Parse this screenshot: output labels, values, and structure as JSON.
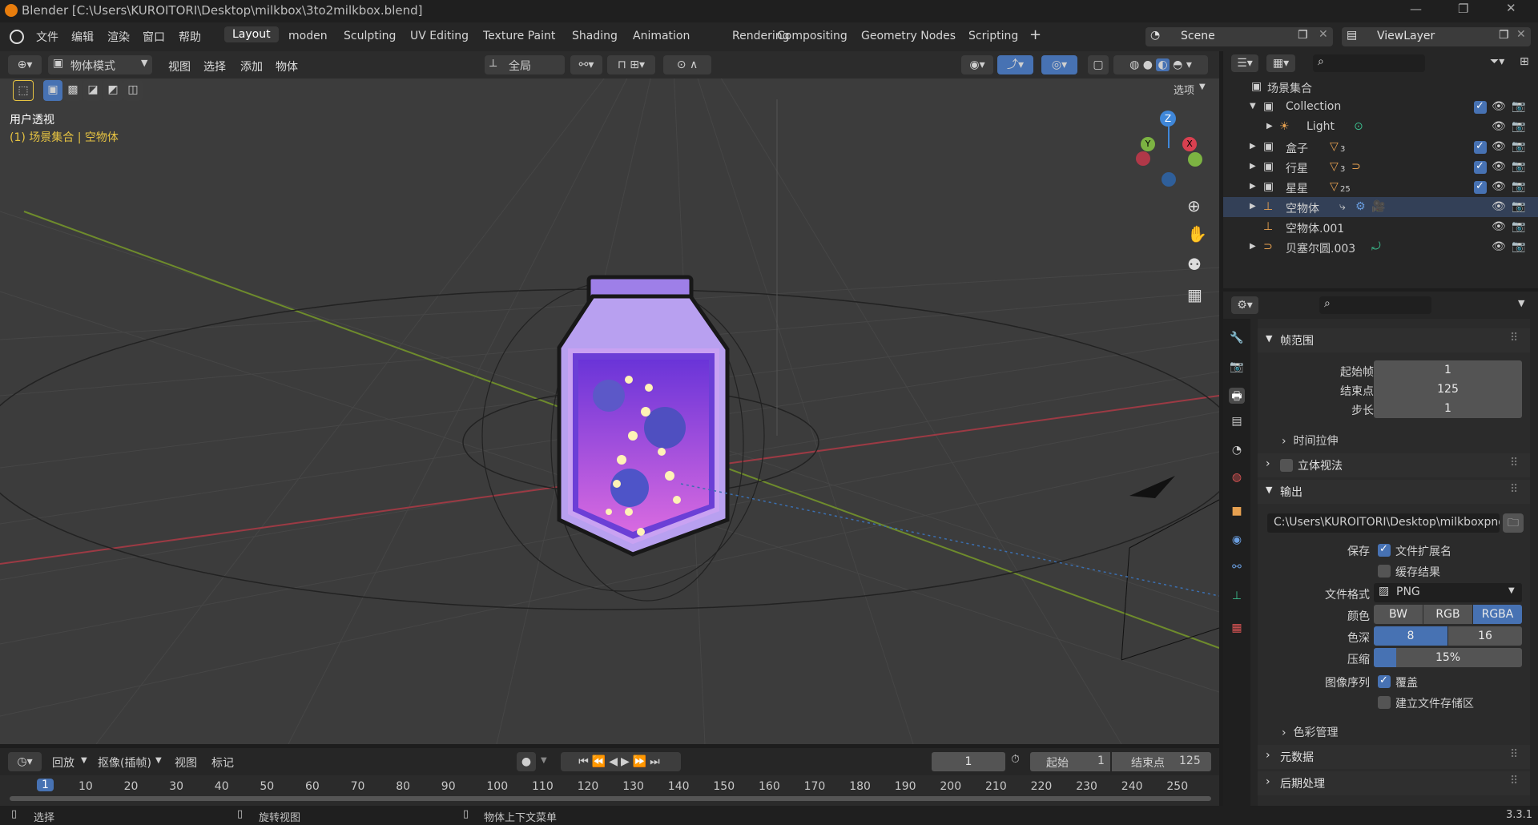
{
  "window": {
    "title": "Blender [C:\\Users\\KUROITORI\\Desktop\\milkbox\\3to2milkbox.blend]"
  },
  "menu": {
    "items": [
      "文件",
      "编辑",
      "渲染",
      "窗口",
      "帮助"
    ]
  },
  "workspaces": [
    "Layout",
    "moden",
    "Sculpting",
    "UV Editing",
    "Texture Paint",
    "Shading",
    "Animation",
    "Rendering",
    "Compositing",
    "Geometry Nodes",
    "Scripting"
  ],
  "active_workspace": "Layout",
  "scene": {
    "name": "Scene",
    "view_layer": "ViewLayer"
  },
  "viewport": {
    "mode": "物体模式",
    "menus": [
      "视图",
      "选择",
      "添加",
      "物体"
    ],
    "transform_orientation": "全局",
    "options_label": "选项",
    "view_name": "用户透视",
    "context": "(1) 场景集合 | 空物体",
    "gizmo_axes": [
      "Z",
      "Y",
      "X"
    ]
  },
  "outliner": {
    "root": "场景集合",
    "rows": [
      {
        "label": "Collection",
        "badge": ""
      },
      {
        "label": "Light",
        "badge": ""
      },
      {
        "label": "盒子",
        "badge": "3"
      },
      {
        "label": "行星",
        "badge": "3"
      },
      {
        "label": "星星",
        "badge": "25"
      },
      {
        "label": "空物体",
        "badge": ""
      },
      {
        "label": "空物体.001",
        "badge": ""
      },
      {
        "label": "贝塞尔圆.003",
        "badge": ""
      }
    ]
  },
  "properties": {
    "frame_range": {
      "title": "帧范围",
      "start_label": "起始帧",
      "start": "1",
      "end_label": "结束点",
      "end": "125",
      "step_label": "步长",
      "step": "1",
      "time_stretch": "时间拉伸"
    },
    "stereoscopy": "立体视法",
    "output": {
      "title": "输出",
      "path": "C:\\Users\\KUROITORI\\Desktop\\milkboxpng\\",
      "save_label": "保存",
      "file_ext": "文件扩展名",
      "cache_result": "缓存结果",
      "format_label": "文件格式",
      "format": "PNG",
      "color_label": "颜色",
      "color_options": [
        "BW",
        "RGB",
        "RGBA"
      ],
      "color_selected": "RGBA",
      "depth_label": "色深",
      "depth_options": [
        "8",
        "16"
      ],
      "depth_selected": "8",
      "compression_label": "压缩",
      "compression": "15%",
      "compression_fraction": 0.15,
      "sequence_label": "图像序列",
      "overwrite": "覆盖",
      "placeholders": "建立文件存储区",
      "color_management": "色彩管理"
    },
    "metadata": "元数据",
    "post_processing": "后期处理"
  },
  "timeline": {
    "menus": [
      "回放",
      "抠像(插帧)",
      "视图",
      "标记"
    ],
    "current_frame": "1",
    "start_label": "起始",
    "start": "1",
    "end_label": "结束点",
    "end": "125",
    "ticks": [
      "1",
      "10",
      "20",
      "30",
      "40",
      "50",
      "60",
      "70",
      "80",
      "90",
      "100",
      "110",
      "120",
      "130",
      "140",
      "150",
      "160",
      "170",
      "180",
      "190",
      "200",
      "210",
      "220",
      "230",
      "240",
      "250"
    ]
  },
  "status": {
    "select": "选择",
    "rotate": "旋转视图",
    "context_menu": "物体上下文菜单",
    "version": "3.3.1"
  },
  "colors": {
    "accent": "#4772b3",
    "x_axis": "#d94050",
    "y_axis": "#8bc34a",
    "z_axis": "#3f87d9",
    "selected_text": "#e6c342"
  }
}
